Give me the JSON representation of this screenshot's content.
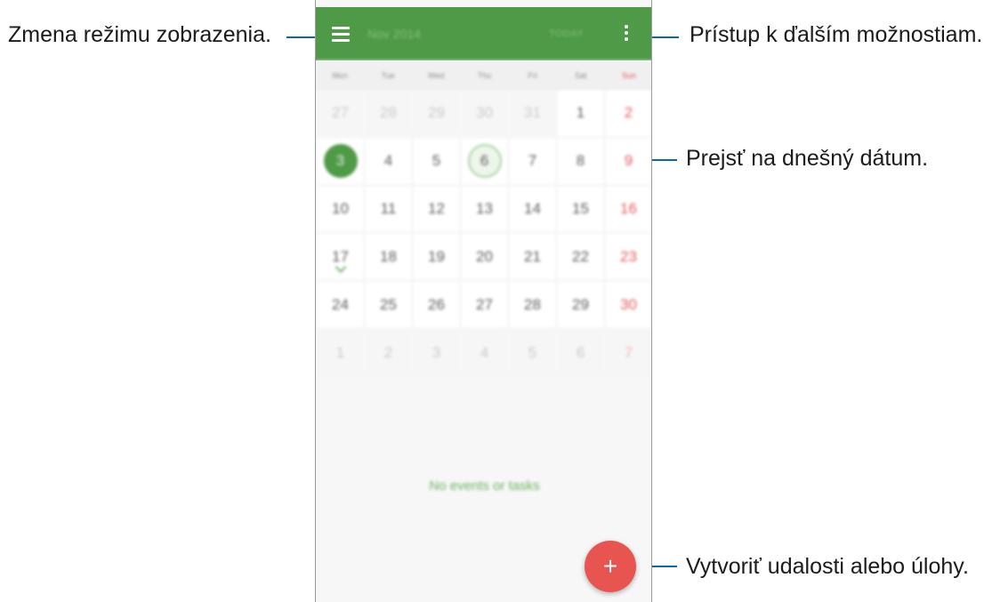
{
  "callouts": {
    "view_mode": "Zmena režimu zobrazenia.",
    "more_options": "Prístup k ďalším možnostiam.",
    "go_today": "Prejsť na dnešný dátum.",
    "create": "Vytvoriť udalosti alebo úlohy."
  },
  "appbar": {
    "menu_icon": "hamburger-menu-icon",
    "month": "Nov 2014",
    "today": "TODAY",
    "more_icon": "more-vertical-icon"
  },
  "weekdays": [
    "Mon",
    "Tue",
    "Wed",
    "Thu",
    "Fri",
    "Sat",
    "Sun"
  ],
  "calendar": {
    "rows": [
      [
        "27",
        "28",
        "29",
        "30",
        "31",
        "1",
        "2"
      ],
      [
        "3",
        "4",
        "5",
        "6",
        "7",
        "8",
        "9"
      ],
      [
        "10",
        "11",
        "12",
        "13",
        "14",
        "15",
        "16"
      ],
      [
        "17",
        "18",
        "19",
        "20",
        "21",
        "22",
        "23"
      ],
      [
        "24",
        "25",
        "26",
        "27",
        "28",
        "29",
        "30"
      ],
      [
        "1",
        "2",
        "3",
        "4",
        "5",
        "6",
        "7"
      ]
    ],
    "selected_day": "3",
    "today_day": "6",
    "event_day": "17"
  },
  "events": {
    "empty_message": "No events or tasks"
  },
  "fab": {
    "label": "+",
    "icon": "add-icon"
  },
  "colors": {
    "appbar": "#4e9a46",
    "accent_green": "#6ab15f",
    "sunday_red": "#e2555a",
    "fab_red": "#e85450",
    "callout_line": "#0a67a8"
  }
}
